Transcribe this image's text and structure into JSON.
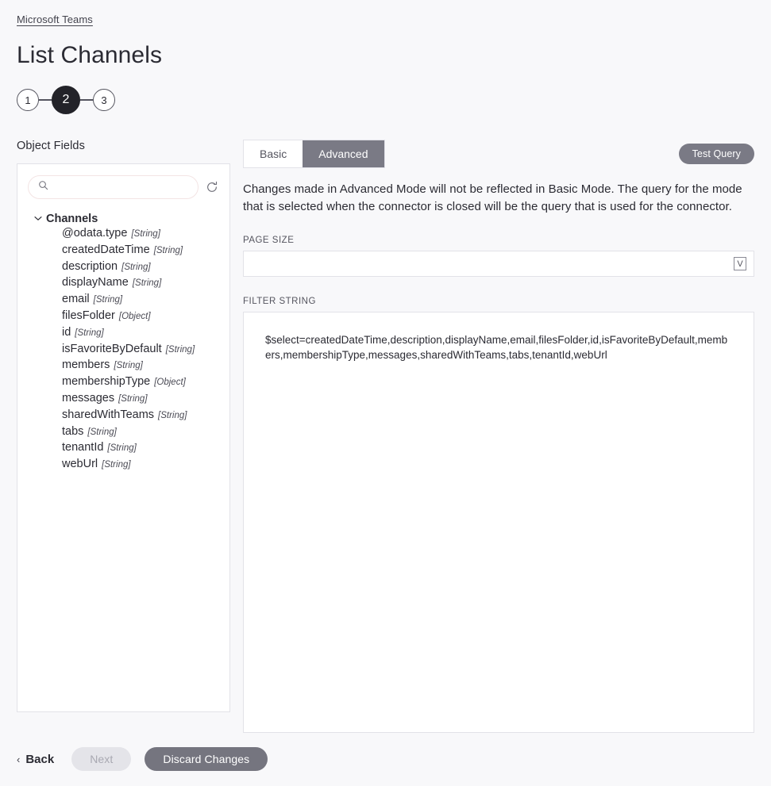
{
  "breadcrumb": {
    "label": "Microsoft Teams"
  },
  "page": {
    "title": "List Channels"
  },
  "stepper": {
    "steps": [
      {
        "label": "1",
        "state": "complete"
      },
      {
        "label": "2",
        "state": "current"
      },
      {
        "label": "3",
        "state": "upcoming"
      }
    ]
  },
  "object_fields": {
    "heading": "Object Fields",
    "search": {
      "value": "",
      "placeholder": ""
    },
    "refresh_title": "Refresh",
    "tree": {
      "root_label": "Channels",
      "expanded": true,
      "fields": [
        {
          "name": "@odata.type",
          "type": "[String]"
        },
        {
          "name": "createdDateTime",
          "type": "[String]"
        },
        {
          "name": "description",
          "type": "[String]"
        },
        {
          "name": "displayName",
          "type": "[String]"
        },
        {
          "name": "email",
          "type": "[String]"
        },
        {
          "name": "filesFolder",
          "type": "[Object]"
        },
        {
          "name": "id",
          "type": "[String]"
        },
        {
          "name": "isFavoriteByDefault",
          "type": "[String]"
        },
        {
          "name": "members",
          "type": "[String]"
        },
        {
          "name": "membershipType",
          "type": "[Object]"
        },
        {
          "name": "messages",
          "type": "[String]"
        },
        {
          "name": "sharedWithTeams",
          "type": "[String]"
        },
        {
          "name": "tabs",
          "type": "[String]"
        },
        {
          "name": "tenantId",
          "type": "[String]"
        },
        {
          "name": "webUrl",
          "type": "[String]"
        }
      ]
    }
  },
  "query_panel": {
    "tabs": [
      {
        "label": "Basic",
        "active": false
      },
      {
        "label": "Advanced",
        "active": true
      }
    ],
    "test_query_label": "Test Query",
    "mode_note": "Changes made in Advanced Mode will not be reflected in Basic Mode. The query for the mode that is selected when the connector is closed will be the query that is used for the connector.",
    "page_size": {
      "label": "PAGE SIZE",
      "value": "",
      "placeholder": "",
      "variable_icon_label": "V"
    },
    "filter_string": {
      "label": "FILTER STRING",
      "value": "$select=createdDateTime,description,displayName,email,filesFolder,id,isFavoriteByDefault,members,membershipType,messages,sharedWithTeams,tabs,tenantId,webUrl"
    }
  },
  "footer": {
    "back_label": "Back",
    "back_chevron": "‹",
    "next_label": "Next",
    "discard_label": "Discard Changes"
  },
  "colors": {
    "page_background": "#f8f8fa",
    "panel_background": "#ffffff",
    "panel_border": "#e2e2e8",
    "accent_dark": "#232329",
    "accent_gray": "#7a7a85",
    "text_primary": "#2b2b33",
    "text_muted": "#55555f",
    "disabled_bg": "#e4e4e9",
    "disabled_text": "#a9a9b2",
    "search_border": "#f3e4e4"
  }
}
